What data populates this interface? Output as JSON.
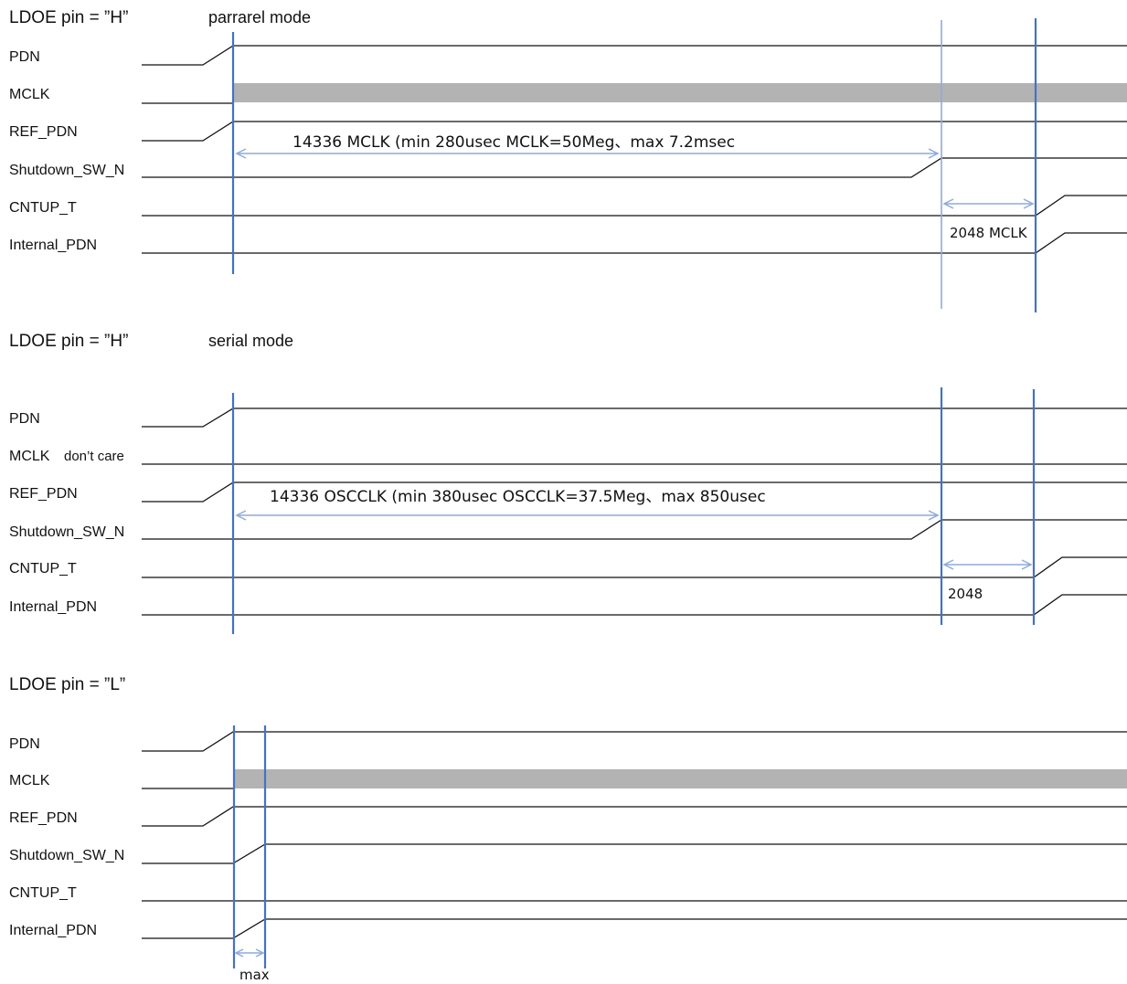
{
  "colors": {
    "marker": "#4472c4",
    "marker_light": "#8faadc",
    "wave": "#111111",
    "bus": "#b3b3b3"
  },
  "sections": [
    {
      "heading": "LDOE pin = ”H”",
      "mode": "parrarel mode",
      "signals": [
        "PDN",
        "MCLK",
        "REF_PDN",
        "Shutdown_SW_N",
        "CNTUP_T",
        "Internal_PDN"
      ],
      "notes": [],
      "annotations": [
        "14336 MCLK  (min 280usec MCLK=50Meg、max  7.2msec",
        "2048 MCLK"
      ]
    },
    {
      "heading": "LDOE pin = ”H”",
      "mode": "serial mode",
      "signals": [
        "PDN",
        "MCLK",
        "REF_PDN",
        "Shutdown_SW_N",
        "CNTUP_T",
        "Internal_PDN"
      ],
      "notes": [
        "don’t care"
      ],
      "annotations": [
        "14336 OSCCLK (min 380usec OSCCLK=37.5Meg、max  850usec",
        "2048"
      ]
    },
    {
      "heading": "LDOE pin = ”L”",
      "mode": "",
      "signals": [
        "PDN",
        "MCLK",
        "REF_PDN",
        "Shutdown_SW_N",
        "CNTUP_T",
        "Internal_PDN"
      ],
      "notes": [],
      "annotations": [
        "max"
      ]
    }
  ]
}
